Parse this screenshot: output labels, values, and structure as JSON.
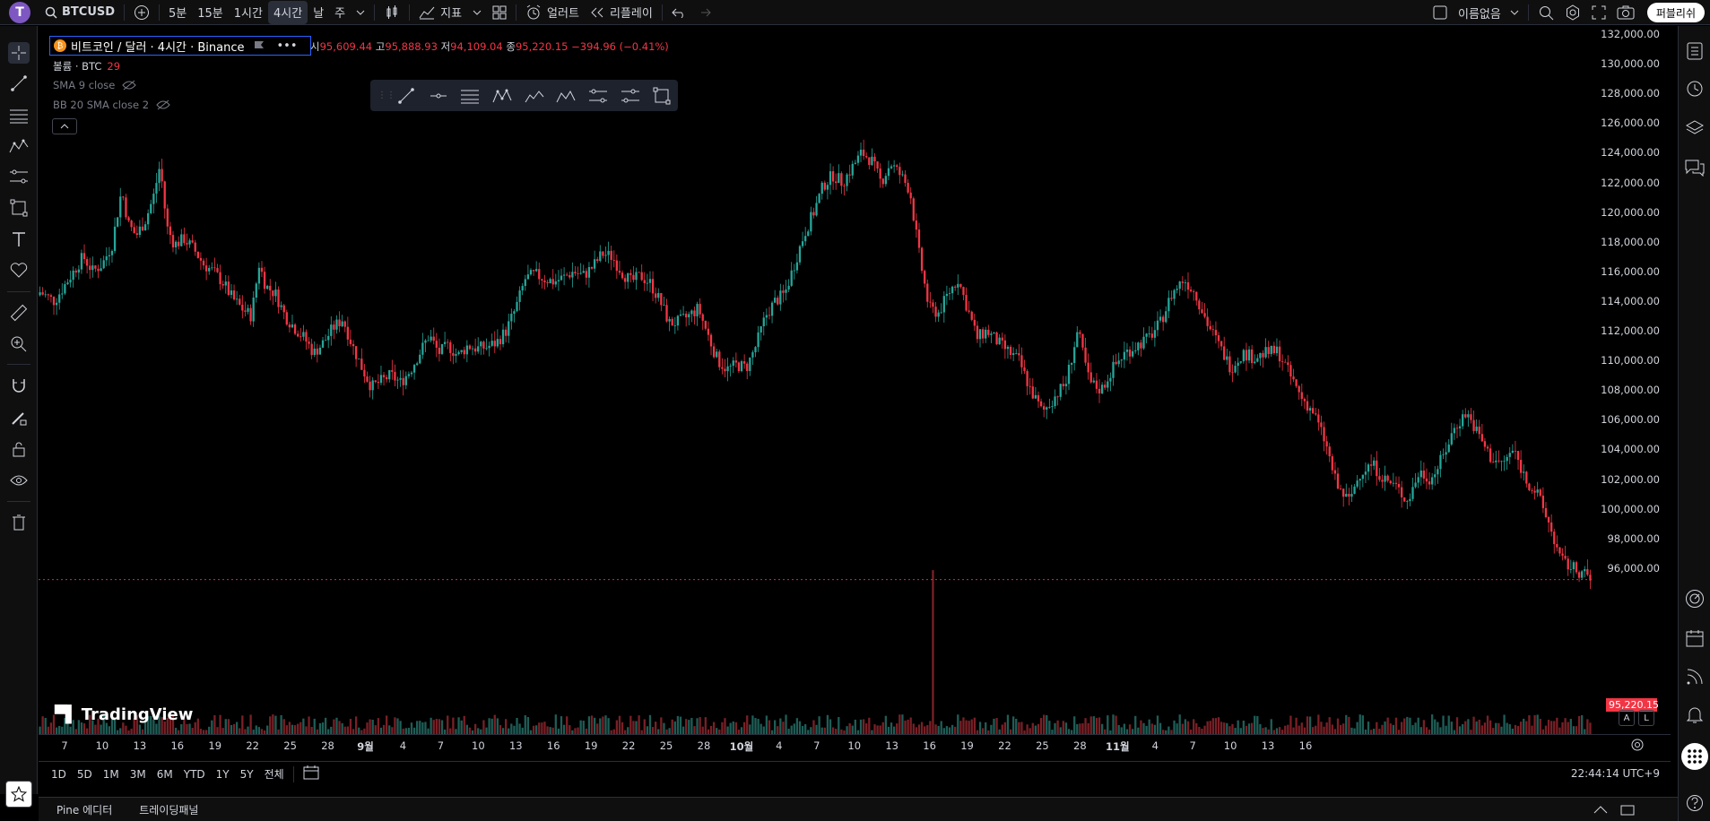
{
  "topbar": {
    "avatar_letter": "T",
    "symbol": "BTCUSD",
    "intervals": [
      "5분",
      "15분",
      "1시간",
      "4시간",
      "날",
      "주"
    ],
    "active_interval": "4시간",
    "indicators_label": "지표",
    "alert_label": "얼러트",
    "replay_label": "리플레이",
    "layout_name": "이름없음",
    "publish_label": "퍼블리쉬"
  },
  "legend": {
    "title": "비트코인 / 달러 · 4시간 · Binance",
    "coin_glyph": "₿",
    "open_label": "시",
    "open": "95,609.44",
    "high_label": "고",
    "high": "95,888.93",
    "low_label": "저",
    "low": "94,109.04",
    "close_label": "종",
    "close": "95,220.15",
    "change": "−394.96 (−0.41%)",
    "volume_label": "볼륨 · BTC",
    "volume_value": "29",
    "sma_label": "SMA 9 close",
    "bb_label": "BB 20 SMA close 2"
  },
  "price_axis": {
    "labels": [
      "132,000.00",
      "130,000.00",
      "128,000.00",
      "126,000.00",
      "124,000.00",
      "122,000.00",
      "120,000.00",
      "118,000.00",
      "116,000.00",
      "114,000.00",
      "112,000.00",
      "110,000.00",
      "108,000.00",
      "106,000.00",
      "104,000.00",
      "102,000.00",
      "100,000.00",
      "98,000.00",
      "96,000.00"
    ],
    "current_price": "95,220.15"
  },
  "time_axis": {
    "labels": [
      "7",
      "10",
      "13",
      "16",
      "19",
      "22",
      "25",
      "28",
      "9월",
      "4",
      "7",
      "10",
      "13",
      "16",
      "19",
      "22",
      "25",
      "28",
      "10월",
      "4",
      "7",
      "10",
      "13",
      "16",
      "19",
      "22",
      "25",
      "28",
      "11월",
      "4",
      "7",
      "10",
      "13",
      "16"
    ]
  },
  "range_bar": {
    "ranges": [
      "1D",
      "5D",
      "1M",
      "3M",
      "6M",
      "YTD",
      "1Y",
      "5Y",
      "전체"
    ],
    "clock": "22:44:14 UTC+9"
  },
  "bottom_panel": {
    "tabs": [
      "Pine 에디터",
      "트레이딩패널"
    ]
  },
  "watermark": "TradingView",
  "colors": {
    "up": "#26a69a",
    "down": "#f23645",
    "background": "#000000",
    "accent": "#2962ff"
  },
  "chart_data": {
    "type": "candlestick",
    "symbol": "BTCUSD",
    "interval": "4시간",
    "ylim": [
      94000,
      132500
    ],
    "x_start_label": "7",
    "x_end_label": "16",
    "close_path": [
      [
        0,
        114600
      ],
      [
        0.015,
        114000
      ],
      [
        0.03,
        115500
      ],
      [
        0.045,
        117000
      ],
      [
        0.055,
        116000
      ],
      [
        0.065,
        116500
      ],
      [
        0.075,
        117800
      ],
      [
        0.085,
        121500
      ],
      [
        0.092,
        119200
      ],
      [
        0.1,
        118400
      ],
      [
        0.11,
        119500
      ],
      [
        0.118,
        121000
      ],
      [
        0.125,
        123200
      ],
      [
        0.132,
        119000
      ],
      [
        0.14,
        117800
      ],
      [
        0.15,
        118200
      ],
      [
        0.16,
        117500
      ],
      [
        0.17,
        116500
      ],
      [
        0.18,
        116000
      ],
      [
        0.19,
        115300
      ],
      [
        0.2,
        114200
      ],
      [
        0.21,
        113500
      ],
      [
        0.22,
        113000
      ],
      [
        0.228,
        116500
      ],
      [
        0.235,
        115000
      ],
      [
        0.245,
        114500
      ],
      [
        0.255,
        113000
      ],
      [
        0.265,
        112200
      ],
      [
        0.275,
        111500
      ],
      [
        0.285,
        110500
      ],
      [
        0.295,
        111200
      ],
      [
        0.305,
        112200
      ],
      [
        0.315,
        112800
      ],
      [
        0.325,
        111000
      ],
      [
        0.335,
        109500
      ],
      [
        0.345,
        108200
      ],
      [
        0.355,
        108600
      ],
      [
        0.365,
        109000
      ],
      [
        0.375,
        108500
      ],
      [
        0.385,
        109300
      ],
      [
        0.395,
        110500
      ],
      [
        0.405,
        111700
      ],
      [
        0.415,
        110500
      ],
      [
        0.425,
        111000
      ],
      [
        0.435,
        110300
      ],
      [
        0.445,
        111000
      ],
      [
        0.455,
        110800
      ],
      [
        0.465,
        110900
      ],
      [
        0.475,
        111200
      ],
      [
        0.485,
        112000
      ],
      [
        0.495,
        113500
      ],
      [
        0.505,
        115500
      ],
      [
        0.515,
        115800
      ],
      [
        0.525,
        115500
      ],
      [
        0.535,
        115300
      ],
      [
        0.545,
        115600
      ],
      [
        0.555,
        116000
      ],
      [
        0.565,
        115700
      ],
      [
        0.575,
        116300
      ],
      [
        0.585,
        117200
      ],
      [
        0.595,
        117000
      ],
      [
        0.605,
        116000
      ],
      [
        0.615,
        115300
      ],
      [
        0.625,
        115700
      ],
      [
        0.635,
        115200
      ],
      [
        0.645,
        114000
      ],
      [
        0.655,
        112500
      ],
      [
        0.665,
        112600
      ],
      [
        0.675,
        113000
      ],
      [
        0.685,
        113500
      ],
      [
        0.695,
        111700
      ],
      [
        0.705,
        110000
      ],
      [
        0.715,
        109400
      ],
      [
        0.725,
        109700
      ],
      [
        0.735,
        109500
      ],
      [
        0.745,
        111000
      ],
      [
        0.755,
        113000
      ],
      [
        0.765,
        114000
      ],
      [
        0.775,
        114500
      ],
      [
        0.785,
        116500
      ],
      [
        0.795,
        118500
      ],
      [
        0.805,
        120000
      ],
      [
        0.815,
        121800
      ],
      [
        0.825,
        122500
      ],
      [
        0.835,
        122000
      ],
      [
        0.845,
        123000
      ],
      [
        0.855,
        124000
      ],
      [
        0.865,
        123500
      ],
      [
        0.875,
        122000
      ],
      [
        0.885,
        123300
      ],
      [
        0.895,
        122500
      ],
      [
        0.905,
        121500
      ],
      [
        0.915,
        117000
      ],
      [
        0.925,
        113500
      ],
      [
        0.935,
        113200
      ],
      [
        0.945,
        114500
      ],
      [
        0.955,
        115500
      ],
      [
        0.965,
        113500
      ],
      [
        0.975,
        111500
      ],
      [
        0.985,
        112000
      ],
      [
        1.0,
        111000
      ]
    ],
    "close_path_b": [
      [
        0,
        111000
      ],
      [
        0.03,
        110000
      ],
      [
        0.05,
        108000
      ],
      [
        0.07,
        106500
      ],
      [
        0.09,
        107500
      ],
      [
        0.11,
        108500
      ],
      [
        0.13,
        112000
      ],
      [
        0.15,
        108500
      ],
      [
        0.17,
        108000
      ],
      [
        0.19,
        109500
      ],
      [
        0.21,
        110500
      ],
      [
        0.23,
        111000
      ],
      [
        0.25,
        111500
      ],
      [
        0.27,
        112500
      ],
      [
        0.29,
        114500
      ],
      [
        0.31,
        115500
      ],
      [
        0.33,
        114500
      ],
      [
        0.35,
        112500
      ],
      [
        0.37,
        111000
      ],
      [
        0.39,
        109500
      ],
      [
        0.41,
        110500
      ],
      [
        0.43,
        110200
      ],
      [
        0.45,
        110500
      ],
      [
        0.47,
        110600
      ],
      [
        0.49,
        109000
      ],
      [
        0.51,
        107500
      ],
      [
        0.53,
        106500
      ],
      [
        0.55,
        104500
      ],
      [
        0.57,
        101500
      ],
      [
        0.59,
        100500
      ],
      [
        0.61,
        102500
      ],
      [
        0.63,
        103000
      ],
      [
        0.65,
        102000
      ],
      [
        0.67,
        101500
      ],
      [
        0.69,
        100500
      ],
      [
        0.71,
        102500
      ],
      [
        0.73,
        102000
      ],
      [
        0.75,
        103500
      ],
      [
        0.77,
        105500
      ],
      [
        0.79,
        106500
      ],
      [
        0.81,
        105000
      ],
      [
        0.83,
        103500
      ],
      [
        0.85,
        103000
      ],
      [
        0.87,
        104000
      ],
      [
        0.89,
        102000
      ],
      [
        0.91,
        101000
      ],
      [
        0.93,
        99000
      ],
      [
        0.95,
        96500
      ],
      [
        0.97,
        96000
      ],
      [
        0.99,
        95600
      ],
      [
        1.0,
        95220
      ]
    ]
  }
}
